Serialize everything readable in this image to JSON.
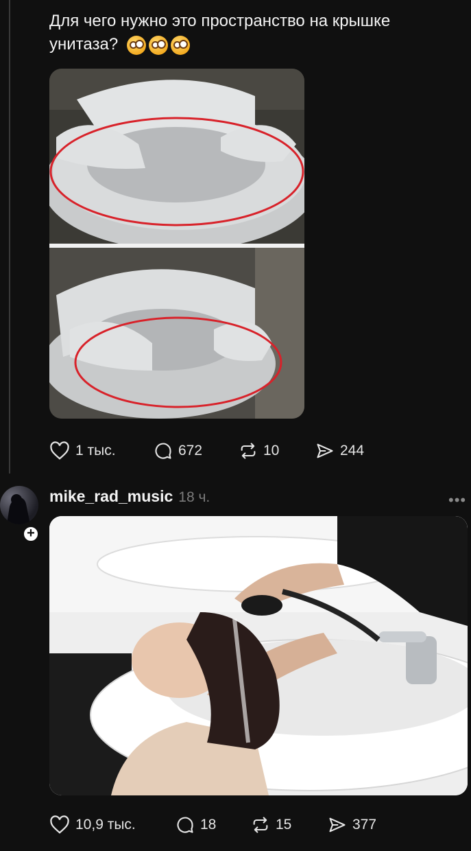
{
  "post1": {
    "text": "Для чего нужно это пространство на крышке унитаза?",
    "emojis": [
      "face-with-monocle",
      "face-with-monocle",
      "face-with-monocle"
    ],
    "likes": "1 тыс.",
    "replies": "672",
    "reposts": "10",
    "shares": "244"
  },
  "post2": {
    "username": "mike_rad_music",
    "time": "18 ч.",
    "follow_symbol": "+",
    "more_symbol": "•••",
    "likes": "10,9 тыс.",
    "replies": "18",
    "reposts": "15",
    "shares": "377"
  },
  "colors": {
    "background": "#101010",
    "text": "#f2f2f2",
    "muted": "#7c7c7c",
    "highlight_circle": "#d8222a"
  }
}
